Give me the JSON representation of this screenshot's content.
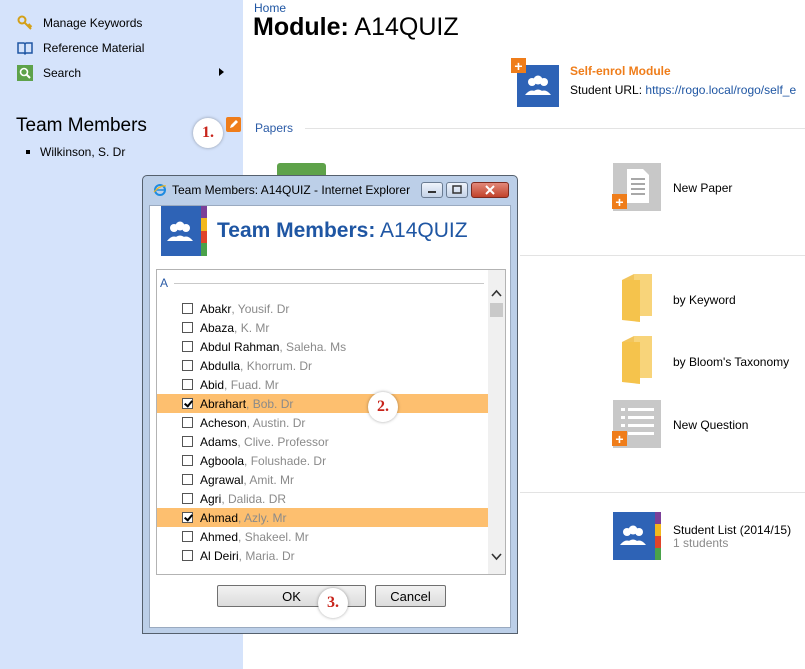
{
  "sidebar": {
    "items": [
      {
        "label": "Manage Keywords",
        "icon": "key-icon"
      },
      {
        "label": "Reference Material",
        "icon": "book-icon"
      },
      {
        "label": "Search",
        "icon": "search-icon"
      }
    ],
    "team_title": "Team Members",
    "team_members": [
      "Wilkinson, S. Dr"
    ]
  },
  "callouts": [
    "1.",
    "2.",
    "3."
  ],
  "header": {
    "breadcrumb": "Home",
    "title_prefix": "Module:",
    "title_code": "A14QUIZ"
  },
  "enrol": {
    "title": "Self-enrol Module",
    "url_label": "Student URL:",
    "url": "https://rogo.local/rogo/self_e"
  },
  "papers": {
    "section_label": "Papers",
    "new_paper": "New Paper",
    "by_keyword": "by Keyword",
    "by_blooms": "by Bloom's Taxonomy",
    "new_question": "New Question",
    "student_list": "Student List (2014/15)",
    "student_count": "1 students"
  },
  "dialog": {
    "window_title": "Team Members: A14QUIZ - Internet Explorer",
    "heading_prefix": "Team Members:",
    "heading_code": "A14QUIZ",
    "letter": "A",
    "people": [
      {
        "surname": "Abakr",
        "rest": ", Yousif. Dr",
        "checked": false
      },
      {
        "surname": "Abaza",
        "rest": ", K. Mr",
        "checked": false
      },
      {
        "surname": "Abdul Rahman",
        "rest": ", Saleha. Ms",
        "checked": false
      },
      {
        "surname": "Abdulla",
        "rest": ", Khorrum. Dr",
        "checked": false
      },
      {
        "surname": "Abid",
        "rest": ", Fuad. Mr",
        "checked": false
      },
      {
        "surname": "Abrahart",
        "rest": ", Bob. Dr",
        "checked": true
      },
      {
        "surname": "Acheson",
        "rest": ", Austin. Dr",
        "checked": false
      },
      {
        "surname": "Adams",
        "rest": ", Clive. Professor",
        "checked": false
      },
      {
        "surname": "Agboola",
        "rest": ", Folushade. Dr",
        "checked": false
      },
      {
        "surname": "Agrawal",
        "rest": ", Amit. Mr",
        "checked": false
      },
      {
        "surname": "Agri",
        "rest": ", Dalida. DR",
        "checked": false
      },
      {
        "surname": "Ahmad",
        "rest": ", Azly. Mr",
        "checked": true
      },
      {
        "surname": "Ahmed",
        "rest": ", Shakeel. Mr",
        "checked": false
      },
      {
        "surname": "Al Deiri",
        "rest": ", Maria. Dr",
        "checked": false
      }
    ],
    "ok_label": "OK",
    "cancel_label": "Cancel"
  },
  "colors": {
    "sidebar_bg": "#d5e3fb",
    "accent_orange": "#ef7d1a",
    "brand_blue": "#2e63b6",
    "selected_row": "#fdbf6f"
  }
}
